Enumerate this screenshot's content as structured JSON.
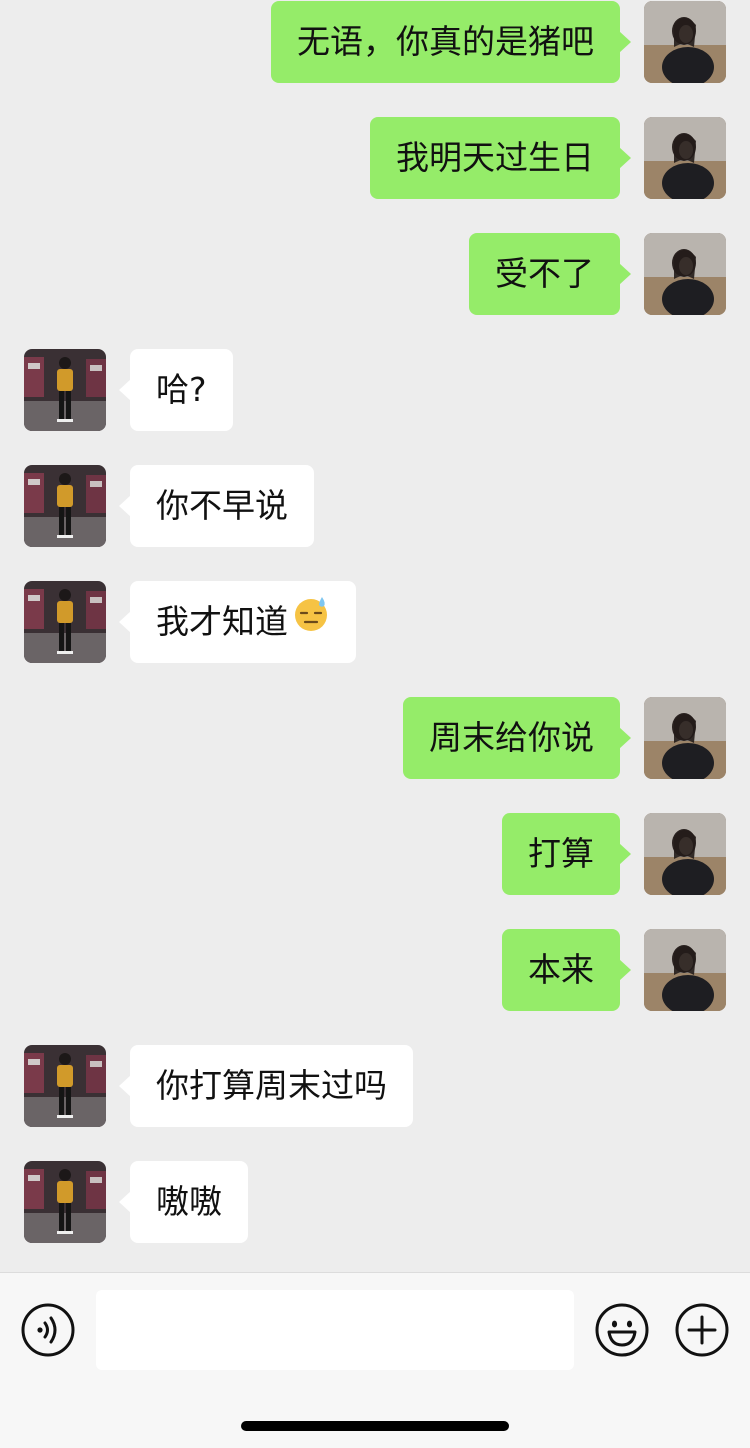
{
  "conversation": {
    "messages": [
      {
        "from": "me",
        "text": "无语，你真的是猪吧"
      },
      {
        "from": "me",
        "text": "我明天过生日"
      },
      {
        "from": "me",
        "text": "受不了"
      },
      {
        "from": "other",
        "text": "哈?"
      },
      {
        "from": "other",
        "text": "你不早说"
      },
      {
        "from": "other",
        "text": "我才知道",
        "emoji": "cold-sweat-emoji"
      },
      {
        "from": "me",
        "text": "周末给你说"
      },
      {
        "from": "me",
        "text": "打算"
      },
      {
        "from": "me",
        "text": "本来"
      },
      {
        "from": "other",
        "text": "你打算周末过吗"
      },
      {
        "from": "other",
        "text": "嗷嗷"
      }
    ]
  },
  "input_bar": {
    "value": "",
    "placeholder": "",
    "icons": [
      "voice-icon",
      "emoji-face-icon",
      "plus-icon"
    ]
  },
  "colors": {
    "background": "#ededed",
    "my_bubble": "#95ec69",
    "other_bubble": "#ffffff",
    "input_bar": "#f7f7f7"
  }
}
